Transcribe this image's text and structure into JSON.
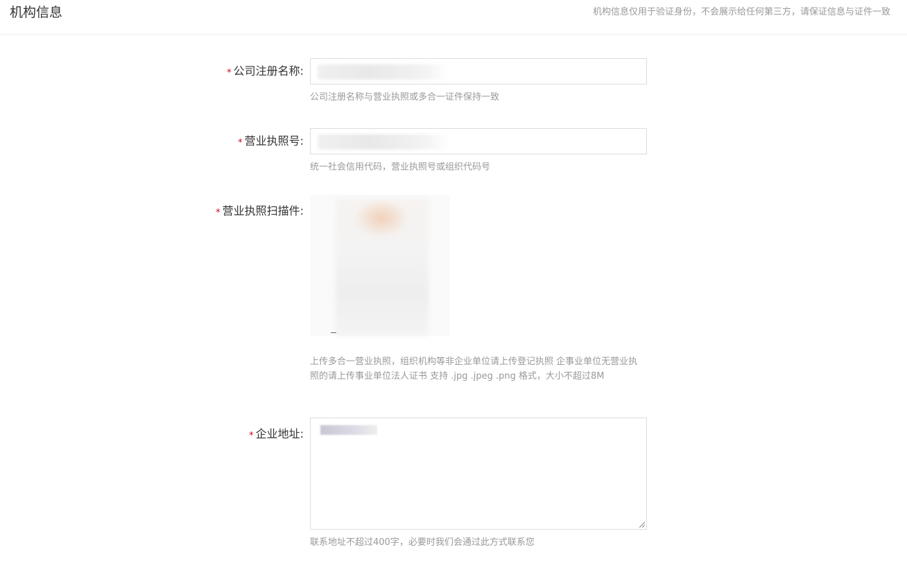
{
  "header": {
    "title": "机构信息",
    "note": "机构信息仅用于验证身份，不会展示给任何第三方，请保证信息与证件一致"
  },
  "form": {
    "required_mark": "*",
    "company_name": {
      "label": "公司注册名称:",
      "value": "",
      "hint": "公司注册名称与营业执照或多合一证件保持一致"
    },
    "license_number": {
      "label": "营业执照号:",
      "value": "",
      "hint": "统一社会信用代码，营业执照号或组织代码号"
    },
    "license_scan": {
      "label": "营业执照扫描件:",
      "hint": "上传多合一营业执照，组织机构等非企业单位请上传登记执照 企事业单位无营业执照的请上传事业单位法人证书 支持 .jpg .jpeg .png 格式，大小不超过8M"
    },
    "address": {
      "label": "企业地址:",
      "value": "",
      "hint": "联系地址不超过400字，必要时我们会通过此方式联系您"
    }
  },
  "colors": {
    "required": "#d0021b",
    "hint_text": "#999999",
    "border": "#dcdcdc"
  }
}
